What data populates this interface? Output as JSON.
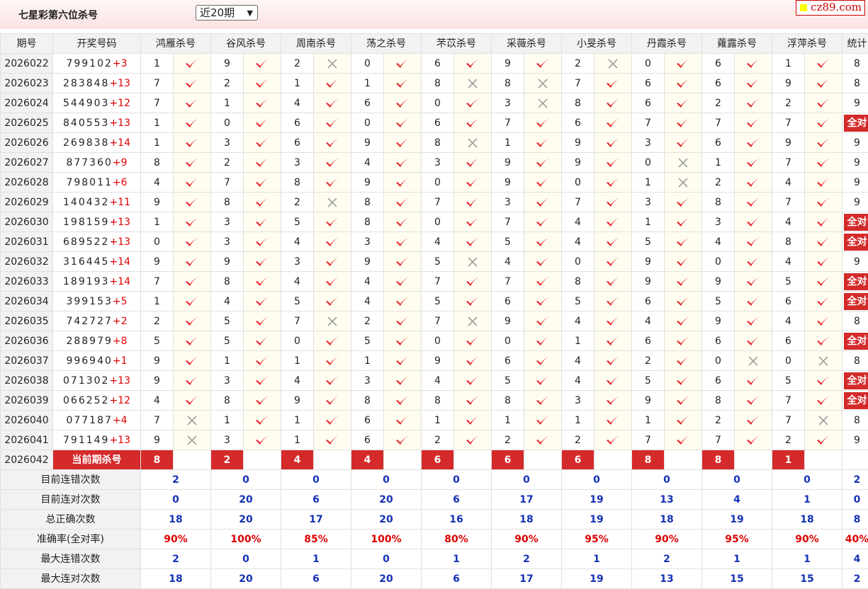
{
  "header": {
    "title": "七星彩第六位杀号",
    "period_select": "近20期",
    "logo": "cz89.com"
  },
  "columns": {
    "period": "期号",
    "draw": "开奖号码",
    "experts": [
      "鸿雁杀号",
      "谷风杀号",
      "周南杀号",
      "荡之杀号",
      "芣苡杀号",
      "采薇杀号",
      "小旻杀号",
      "丹霞杀号",
      "蕹露杀号",
      "浮萍杀号"
    ],
    "stats": "统计"
  },
  "rows": [
    {
      "period": "2026022",
      "draw": "799102",
      "extra": "+3",
      "kills": [
        1,
        9,
        2,
        0,
        6,
        9,
        2,
        0,
        6,
        1
      ],
      "marks": [
        1,
        1,
        0,
        1,
        1,
        1,
        0,
        1,
        1,
        1
      ],
      "stat": "8"
    },
    {
      "period": "2026023",
      "draw": "283848",
      "extra": "+13",
      "kills": [
        7,
        2,
        1,
        1,
        8,
        8,
        7,
        6,
        6,
        9
      ],
      "marks": [
        1,
        1,
        1,
        1,
        0,
        0,
        1,
        1,
        1,
        1
      ],
      "stat": "8"
    },
    {
      "period": "2026024",
      "draw": "544903",
      "extra": "+12",
      "kills": [
        7,
        1,
        4,
        6,
        0,
        3,
        8,
        6,
        2,
        2
      ],
      "marks": [
        1,
        1,
        1,
        1,
        1,
        0,
        1,
        1,
        1,
        1
      ],
      "stat": "9"
    },
    {
      "period": "2026025",
      "draw": "840553",
      "extra": "+13",
      "kills": [
        1,
        0,
        6,
        0,
        6,
        7,
        6,
        7,
        7,
        7
      ],
      "marks": [
        1,
        1,
        1,
        1,
        1,
        1,
        1,
        1,
        1,
        1
      ],
      "stat": "全对"
    },
    {
      "period": "2026026",
      "draw": "269838",
      "extra": "+14",
      "kills": [
        1,
        3,
        6,
        9,
        8,
        1,
        9,
        3,
        6,
        9
      ],
      "marks": [
        1,
        1,
        1,
        1,
        0,
        1,
        1,
        1,
        1,
        1
      ],
      "stat": "9"
    },
    {
      "period": "2026027",
      "draw": "877360",
      "extra": "+9",
      "kills": [
        8,
        2,
        3,
        4,
        3,
        9,
        9,
        0,
        1,
        7
      ],
      "marks": [
        1,
        1,
        1,
        1,
        1,
        1,
        1,
        0,
        1,
        1
      ],
      "stat": "9"
    },
    {
      "period": "2026028",
      "draw": "798011",
      "extra": "+6",
      "kills": [
        4,
        7,
        8,
        9,
        0,
        9,
        0,
        1,
        2,
        4
      ],
      "marks": [
        1,
        1,
        1,
        1,
        1,
        1,
        1,
        0,
        1,
        1
      ],
      "stat": "9"
    },
    {
      "period": "2026029",
      "draw": "140432",
      "extra": "+11",
      "kills": [
        9,
        8,
        2,
        8,
        7,
        3,
        7,
        3,
        8,
        7
      ],
      "marks": [
        1,
        1,
        0,
        1,
        1,
        1,
        1,
        1,
        1,
        1
      ],
      "stat": "9"
    },
    {
      "period": "2026030",
      "draw": "198159",
      "extra": "+13",
      "kills": [
        1,
        3,
        5,
        8,
        0,
        7,
        4,
        1,
        3,
        4
      ],
      "marks": [
        1,
        1,
        1,
        1,
        1,
        1,
        1,
        1,
        1,
        1
      ],
      "stat": "全对"
    },
    {
      "period": "2026031",
      "draw": "689522",
      "extra": "+13",
      "kills": [
        0,
        3,
        4,
        3,
        4,
        5,
        4,
        5,
        4,
        8
      ],
      "marks": [
        1,
        1,
        1,
        1,
        1,
        1,
        1,
        1,
        1,
        1
      ],
      "stat": "全对"
    },
    {
      "period": "2026032",
      "draw": "316445",
      "extra": "+14",
      "kills": [
        9,
        9,
        3,
        9,
        5,
        4,
        0,
        9,
        0,
        4
      ],
      "marks": [
        1,
        1,
        1,
        1,
        0,
        1,
        1,
        1,
        1,
        1
      ],
      "stat": "9"
    },
    {
      "period": "2026033",
      "draw": "189193",
      "extra": "+14",
      "kills": [
        7,
        8,
        4,
        4,
        7,
        7,
        8,
        9,
        9,
        5
      ],
      "marks": [
        1,
        1,
        1,
        1,
        1,
        1,
        1,
        1,
        1,
        1
      ],
      "stat": "全对"
    },
    {
      "period": "2026034",
      "draw": "399153",
      "extra": "+5",
      "kills": [
        1,
        4,
        5,
        4,
        5,
        6,
        5,
        6,
        5,
        6
      ],
      "marks": [
        1,
        1,
        1,
        1,
        1,
        1,
        1,
        1,
        1,
        1
      ],
      "stat": "全对"
    },
    {
      "period": "2026035",
      "draw": "742727",
      "extra": "+2",
      "kills": [
        2,
        5,
        7,
        2,
        7,
        9,
        4,
        4,
        9,
        4
      ],
      "marks": [
        1,
        1,
        0,
        1,
        0,
        1,
        1,
        1,
        1,
        1
      ],
      "stat": "8"
    },
    {
      "period": "2026036",
      "draw": "288979",
      "extra": "+8",
      "kills": [
        5,
        5,
        0,
        5,
        0,
        0,
        1,
        6,
        6,
        6
      ],
      "marks": [
        1,
        1,
        1,
        1,
        1,
        1,
        1,
        1,
        1,
        1
      ],
      "stat": "全对"
    },
    {
      "period": "2026037",
      "draw": "996940",
      "extra": "+1",
      "kills": [
        9,
        1,
        1,
        1,
        9,
        6,
        4,
        2,
        0,
        0
      ],
      "marks": [
        1,
        1,
        1,
        1,
        1,
        1,
        1,
        1,
        0,
        0
      ],
      "stat": "8"
    },
    {
      "period": "2026038",
      "draw": "071302",
      "extra": "+13",
      "kills": [
        9,
        3,
        4,
        3,
        4,
        5,
        4,
        5,
        6,
        5
      ],
      "marks": [
        1,
        1,
        1,
        1,
        1,
        1,
        1,
        1,
        1,
        1
      ],
      "stat": "全对"
    },
    {
      "period": "2026039",
      "draw": "066252",
      "extra": "+12",
      "kills": [
        4,
        8,
        9,
        8,
        8,
        8,
        3,
        9,
        8,
        7
      ],
      "marks": [
        1,
        1,
        1,
        1,
        1,
        1,
        1,
        1,
        1,
        1
      ],
      "stat": "全对"
    },
    {
      "period": "2026040",
      "draw": "077187",
      "extra": "+4",
      "kills": [
        7,
        1,
        1,
        6,
        1,
        1,
        1,
        1,
        2,
        7
      ],
      "marks": [
        0,
        1,
        1,
        1,
        1,
        1,
        1,
        1,
        1,
        0
      ],
      "stat": "8"
    },
    {
      "period": "2026041",
      "draw": "791149",
      "extra": "+13",
      "kills": [
        9,
        3,
        1,
        6,
        2,
        2,
        2,
        7,
        7,
        2
      ],
      "marks": [
        0,
        1,
        1,
        1,
        1,
        1,
        1,
        1,
        1,
        1
      ],
      "stat": "9"
    }
  ],
  "current": {
    "period": "2026042",
    "label": "当前期杀号",
    "kills": [
      "8",
      "2",
      "4",
      "4",
      "6",
      "6",
      "6",
      "8",
      "8",
      "1"
    ]
  },
  "summary": [
    {
      "label": "目前连错次数",
      "values": [
        "2",
        "0",
        "0",
        "0",
        "0",
        "0",
        "0",
        "0",
        "0",
        "0"
      ],
      "stat": "2",
      "red": false
    },
    {
      "label": "目前连对次数",
      "values": [
        "0",
        "20",
        "6",
        "20",
        "6",
        "17",
        "19",
        "13",
        "4",
        "1"
      ],
      "stat": "0",
      "red": false
    },
    {
      "label": "总正确次数",
      "values": [
        "18",
        "20",
        "17",
        "20",
        "16",
        "18",
        "19",
        "18",
        "19",
        "18"
      ],
      "stat": "8",
      "red": false
    },
    {
      "label": "准确率(全对率)",
      "values": [
        "90%",
        "100%",
        "85%",
        "100%",
        "80%",
        "90%",
        "95%",
        "90%",
        "95%",
        "90%"
      ],
      "stat": "40%",
      "red": true
    },
    {
      "label": "最大连错次数",
      "values": [
        "2",
        "0",
        "1",
        "0",
        "1",
        "2",
        "1",
        "2",
        "1",
        "1"
      ],
      "stat": "4",
      "red": false
    },
    {
      "label": "最大连对次数",
      "values": [
        "18",
        "20",
        "6",
        "20",
        "6",
        "17",
        "19",
        "13",
        "15",
        "15"
      ],
      "stat": "2",
      "red": false
    }
  ],
  "icons": {
    "correct": "check-icon",
    "wrong": "cross-icon"
  },
  "colors": {
    "accent_red": "#d42a2a",
    "stat_blue": "#1632b4",
    "check_red": "#e8242b",
    "cross_gray": "#a0a0a0"
  }
}
